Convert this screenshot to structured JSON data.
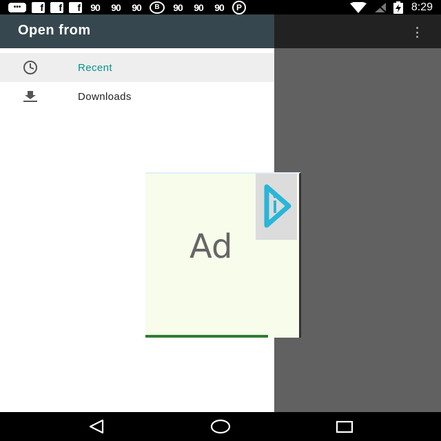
{
  "status_bar": {
    "time": "8:29",
    "left_icons": [
      "messages-icon",
      "facebook-icon",
      "facebook-icon",
      "facebook-icon",
      "hooks-icon",
      "hooks-icon",
      "hooks-icon",
      "bbm-icon",
      "hooks-icon",
      "hooks-icon",
      "hooks-icon",
      "pinterest-icon"
    ],
    "right_icons": [
      "wifi-icon",
      "signal-icon",
      "battery-charging-icon"
    ]
  },
  "drawer": {
    "title": "Open from",
    "items": [
      {
        "label": "Recent",
        "icon": "clock-icon",
        "selected": true
      },
      {
        "label": "Downloads",
        "icon": "download-icon",
        "selected": false
      }
    ]
  },
  "ad": {
    "label": "Ad",
    "choices_icon": "adchoices-icon"
  },
  "colors": {
    "header": "#37474f",
    "accent": "#009688",
    "scrim": "#616161"
  }
}
